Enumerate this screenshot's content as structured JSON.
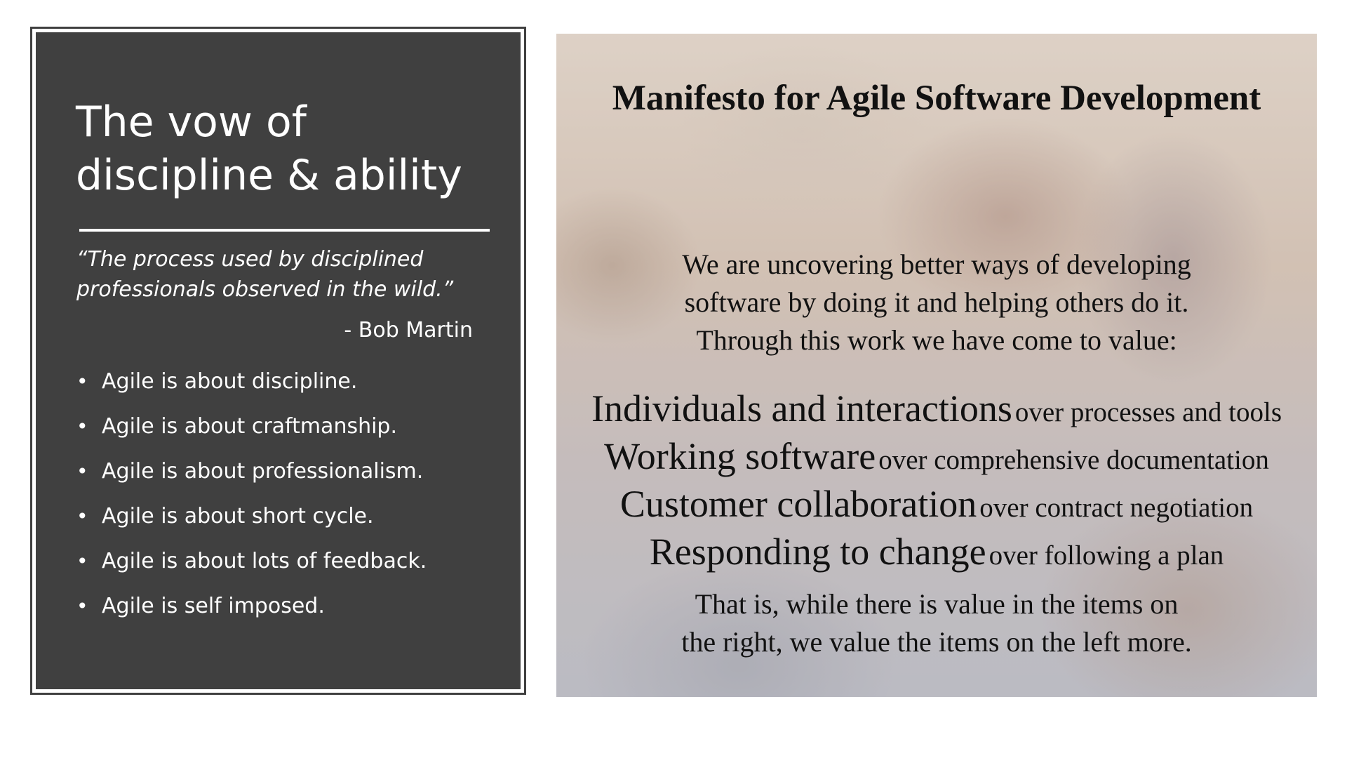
{
  "left_panel": {
    "title_lines": [
      "The vow of",
      "discipline & ability"
    ],
    "quote_lines": [
      "“The process used by disciplined",
      "professionals observed in the wild.”"
    ],
    "attribution": "- Bob Martin",
    "bullet_glyph": "•",
    "bullets": [
      "Agile is about discipline.",
      "Agile is about craftmanship.",
      "Agile is about professionalism.",
      "Agile is about short cycle.",
      "Agile is about lots of feedback.",
      "Agile is self imposed."
    ]
  },
  "manifesto": {
    "title": "Manifesto for Agile Software Development",
    "intro_lines": [
      "We are uncovering better ways of developing",
      "software by doing it and helping others do it.",
      "Through this work we have come to value:"
    ],
    "values": [
      {
        "left": "Individuals and interactions",
        "right": "over processes and tools"
      },
      {
        "left": "Working software",
        "right": "over comprehensive documentation"
      },
      {
        "left": "Customer collaboration",
        "right": "over contract negotiation"
      },
      {
        "left": "Responding to change",
        "right": "over following a plan"
      }
    ],
    "closing_lines": [
      "That is, while there is value in the items on",
      "the right, we value the items on the left more."
    ]
  },
  "colors": {
    "panel_background": "#404040",
    "panel_text": "#ffffff",
    "slide_background": "#ffffff",
    "manifesto_text": "#111111"
  }
}
